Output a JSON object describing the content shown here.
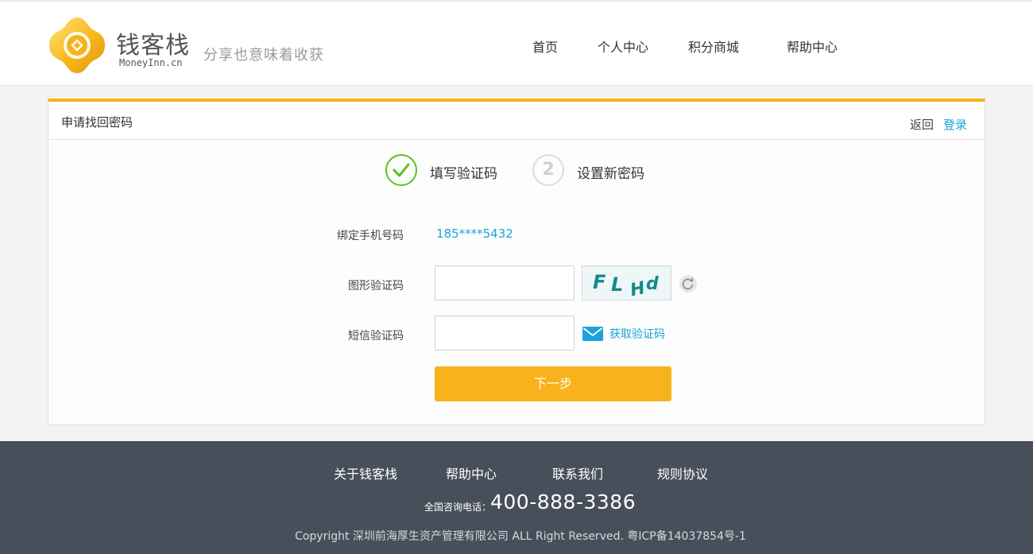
{
  "header": {
    "logo_name": "钱客栈",
    "logo_domain": "MoneyInn.cn",
    "slogan": "分享也意味着收获",
    "nav": [
      {
        "label": "首页"
      },
      {
        "label": "个人中心"
      },
      {
        "label": "积分商城"
      },
      {
        "label": "帮助中心"
      }
    ]
  },
  "panel": {
    "title": "申请找回密码",
    "back_label": "返回",
    "login_label": "登录",
    "steps": [
      {
        "number": "1",
        "label": "填写验证码",
        "status": "done"
      },
      {
        "number": "2",
        "label": "设置新密码",
        "status": "pending"
      }
    ],
    "form": {
      "phone_label": "绑定手机号码",
      "phone_value": "185****5432",
      "captcha_label": "图形验证码",
      "captcha_value": "",
      "captcha_text": "FLHd",
      "sms_label": "短信验证码",
      "sms_value": "",
      "get_code_label": "获取验证码",
      "next_label": "下一步"
    }
  },
  "footer": {
    "links": [
      {
        "label": "关于钱客栈"
      },
      {
        "label": "帮助中心"
      },
      {
        "label": "联系我们"
      },
      {
        "label": "规则协议"
      }
    ],
    "hotline_label": "全国咨询电话：",
    "hotline_number": "400-888-3386",
    "copyright": "Copyright  深圳前海厚生资产管理有限公司  ALL Right Reserved. 粤ICP备14037854号-1"
  },
  "colors": {
    "accent": "#f8b21c",
    "link": "#1aa3dc",
    "success": "#5cc21c",
    "footer_bg": "#474f5b"
  },
  "icons": {
    "logo": "coin-logo-icon",
    "step_done": "check-circle-icon",
    "refresh": "refresh-icon",
    "mail": "envelope-icon"
  }
}
